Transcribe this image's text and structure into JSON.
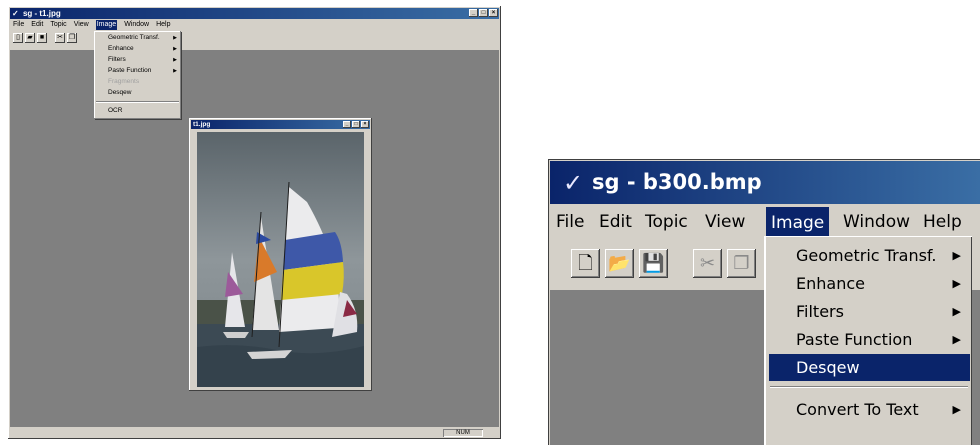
{
  "left": {
    "title": "sg - t1.jpg",
    "menu": [
      "File",
      "Edit",
      "Topic",
      "View",
      "Image",
      "Window",
      "Help"
    ],
    "active_menu_index": 4,
    "image_menu": {
      "items": [
        {
          "label": "Geometric Transf.",
          "submenu": true,
          "disabled": false
        },
        {
          "label": "Enhance",
          "submenu": true,
          "disabled": false
        },
        {
          "label": "Filters",
          "submenu": true,
          "disabled": false
        },
        {
          "label": "Paste Function",
          "submenu": true,
          "disabled": false
        },
        {
          "label": "Fragments",
          "submenu": false,
          "disabled": true
        },
        {
          "label": "Desqew",
          "submenu": false,
          "disabled": false
        },
        {
          "label": "OCR",
          "submenu": false,
          "disabled": false
        }
      ]
    },
    "child_window_title": "t1.jpg",
    "status": {
      "num": "NUM"
    }
  },
  "right": {
    "title": "sg - b300.bmp",
    "menu": [
      "File",
      "Edit",
      "Topic",
      "View",
      "Image",
      "Window",
      "Help"
    ],
    "active_menu_index": 4,
    "image_menu": {
      "items": [
        {
          "label": "Geometric Transf.",
          "submenu": true
        },
        {
          "label": "Enhance",
          "submenu": true
        },
        {
          "label": "Filters",
          "submenu": true
        },
        {
          "label": "Paste Function",
          "submenu": true
        },
        {
          "label": "Desqew",
          "submenu": false,
          "highlighted": true
        },
        {
          "label": "Convert To Text",
          "submenu": true
        }
      ]
    }
  },
  "icons": {
    "app": "checkmark-logo-icon",
    "new": "new-document-icon",
    "open": "open-folder-icon",
    "save": "save-disk-icon",
    "cut": "scissors-icon",
    "copy": "copy-icon",
    "submenu": "triangle-right-icon"
  },
  "colors": {
    "titlebar_start": "#0a246a",
    "titlebar_end": "#3a6ea5",
    "highlight": "#0a246a",
    "face": "#d4d0c8",
    "workspace": "#808080"
  }
}
